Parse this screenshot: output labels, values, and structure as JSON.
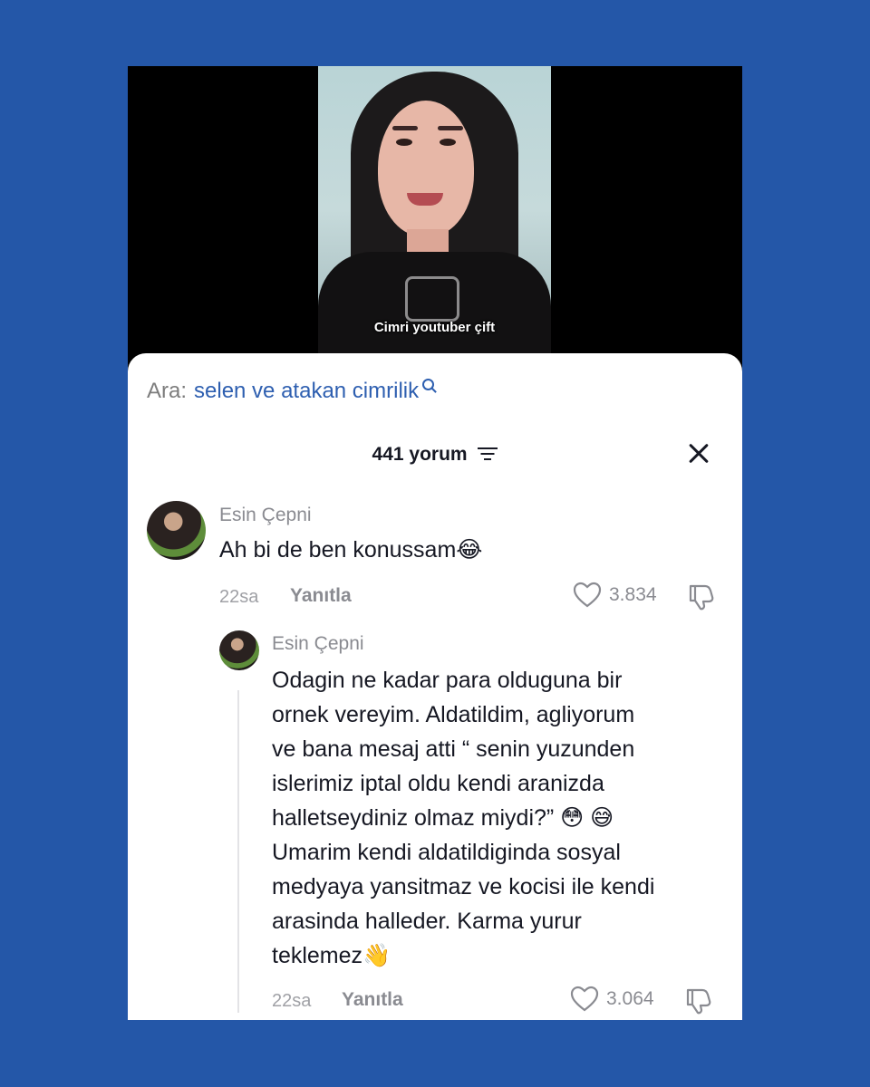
{
  "video": {
    "caption": "Cimri youtuber çift"
  },
  "search": {
    "prefix": "Ara:",
    "query": "selen ve atakan cimrilik"
  },
  "header": {
    "count_label": "441 yorum"
  },
  "comments": [
    {
      "username": "Esin Çepni",
      "text": "Ah bi de ben konussam😂",
      "time": "22sa",
      "reply_label": "Yanıtla",
      "likes": "3.834"
    },
    {
      "username": "Esin Çepni",
      "text_lines": [
        "Odagin ne kadar para olduguna bir",
        "ornek vereyim. Aldatildim, agliyorum",
        "ve bana mesaj atti “ senin yuzunden",
        "islerimiz iptal oldu kendi aranizda",
        "halletseydiniz olmaz miydi?” 😳 😅",
        "Umarim kendi aldatildiginda sosyal",
        "medyaya yansitmaz ve kocisi ile kendi",
        "arasinda halleder. Karma yurur",
        "teklemez👋"
      ],
      "time": "22sa",
      "reply_label": "Yanıtla",
      "likes": "3.064"
    }
  ],
  "colors": {
    "background": "#2457a8",
    "link": "#2e5fb0",
    "muted": "#8a8b91"
  },
  "icons": [
    "search-icon",
    "filter-icon",
    "close-icon",
    "heart-icon",
    "dislike-icon"
  ]
}
